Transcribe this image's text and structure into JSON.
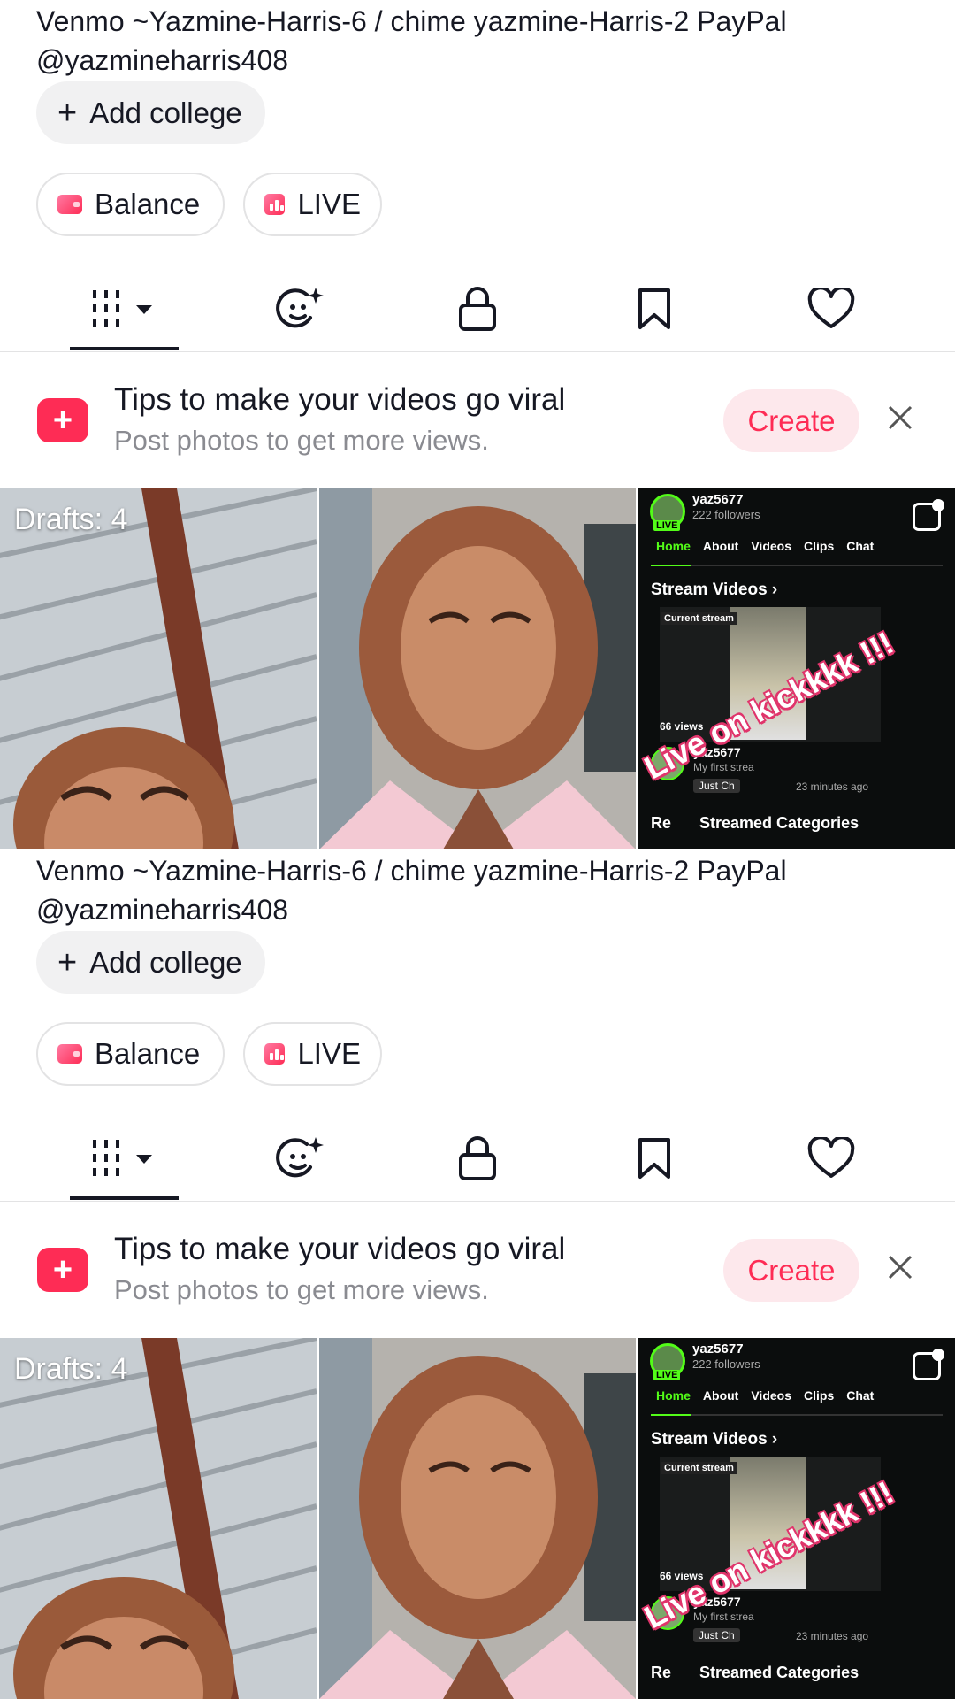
{
  "profile": {
    "bio_line1": "Venmo ~Yazmine-Harris-6 / chime yazmine-Harris-2 PayPal",
    "bio_line2": "@yazmineharris408",
    "add_college_plus": "+",
    "add_college_label": "Add college",
    "balance_label": "Balance",
    "live_label": "LIVE"
  },
  "tabs": [
    {
      "name": "videos",
      "icon": "grid-lines-icon",
      "active": true
    },
    {
      "name": "reposts",
      "icon": "sticker-face-icon"
    },
    {
      "name": "private",
      "icon": "lock-icon"
    },
    {
      "name": "favorites",
      "icon": "bookmark-icon"
    },
    {
      "name": "liked",
      "icon": "heart-icon"
    }
  ],
  "tips": {
    "title": "Tips to make your videos go viral",
    "subtitle": "Post photos to get more views.",
    "create_label": "Create",
    "close_icon": "close-icon"
  },
  "grid": {
    "drafts_label": "Drafts: 4",
    "live_thumb": {
      "username": "yaz5677",
      "followers": "222 followers",
      "live_badge": "LIVE",
      "nav": [
        "Home",
        "About",
        "Videos",
        "Clips",
        "Chat"
      ],
      "stream_videos": "Stream Videos  ›",
      "current_stream": "Current stream",
      "views": "66 views",
      "stream_user": "yaz5677",
      "stream_title": "My first strea",
      "category": "Just Ch",
      "ago": "23 minutes ago",
      "recent_prefix": "Re",
      "recent_label": "Streamed Categories",
      "overlay_text": "Live on kickkkk !!!"
    }
  },
  "colors": {
    "accent": "#fe2c55",
    "kick_green": "#53fc18",
    "text_primary": "#161823",
    "text_secondary": "#8a8b91"
  }
}
